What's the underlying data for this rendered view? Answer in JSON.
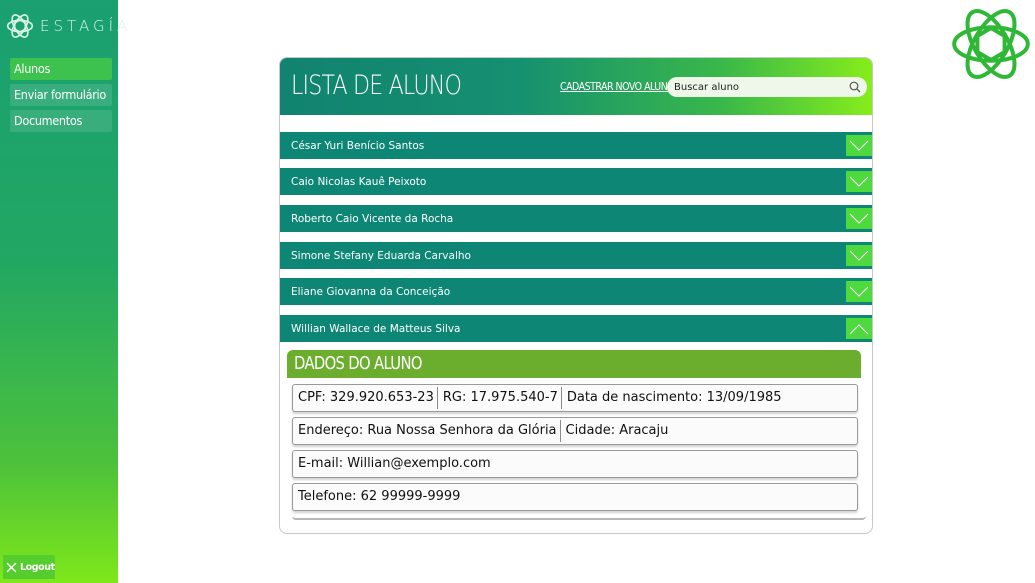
{
  "brand": {
    "name": "ESTAGÍA"
  },
  "sidebar": {
    "items": [
      {
        "label": "Alunos",
        "active": true
      },
      {
        "label": "Enviar formulário",
        "active": false
      },
      {
        "label": "Documentos",
        "active": false
      }
    ],
    "logout_label": "Logout"
  },
  "panel": {
    "title": "LISTA DE ALUNO",
    "register_link": "CADASTRAR NOVO ALUNO",
    "search": {
      "value": "Buscar aluno",
      "placeholder": "Buscar aluno"
    }
  },
  "students": [
    {
      "name": "César Yuri Benício Santos",
      "expanded": false
    },
    {
      "name": "Caio Nicolas Kauê Peixoto",
      "expanded": false
    },
    {
      "name": "Roberto Caio Vicente da Rocha",
      "expanded": false
    },
    {
      "name": "Simone Stefany Eduarda Carvalho",
      "expanded": false
    },
    {
      "name": "Eliane Giovanna da Conceição",
      "expanded": false
    },
    {
      "name": "Willian Wallace de Matteus Silva",
      "expanded": true
    }
  ],
  "details": {
    "title": "DADOS DO ALUNO",
    "cpf": "CPF: 329.920.653-23",
    "rg": "RG: 17.975.540-7",
    "birth": "Data de nascimento: 13/09/1985",
    "address": "Endereço: Rua Nossa Senhora da Glória",
    "city": "Cidade: Aracaju",
    "email": "E-mail: Willian@exemplo.com",
    "phone": "Telefone: 62 99999-9999"
  },
  "colors": {
    "sidebar_top": "#1aa071",
    "sidebar_bottom": "#7ee81a",
    "row": "#0e8676",
    "chevron": "#4ed93e",
    "details_header": "#6bad2d"
  },
  "icons": [
    "hexagon-logo-icon",
    "search-icon",
    "chevron-down-icon",
    "chevron-up-icon",
    "close-icon"
  ]
}
